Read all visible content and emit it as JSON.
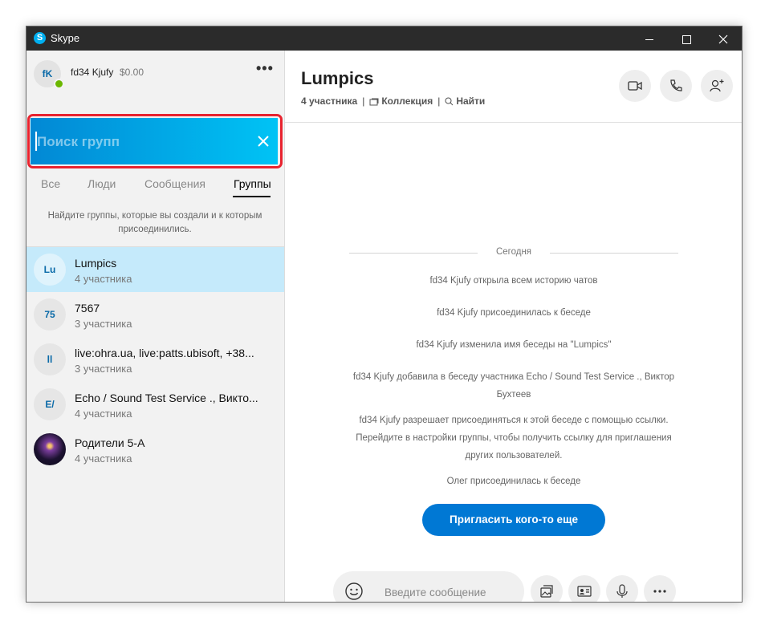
{
  "window": {
    "title": "Skype"
  },
  "profile": {
    "initials": "fK",
    "name": "fd34 Kjufy",
    "balance": "$0.00",
    "more": "•••"
  },
  "search": {
    "placeholder": "Поиск групп",
    "value": ""
  },
  "tabs": [
    {
      "label": "Все",
      "active": false
    },
    {
      "label": "Люди",
      "active": false
    },
    {
      "label": "Сообщения",
      "active": false
    },
    {
      "label": "Группы",
      "active": true
    }
  ],
  "hint": "Найдите группы, которые вы создали и к которым присоединились.",
  "groups": [
    {
      "initials": "Lu",
      "name": "Lumpics",
      "members": "4 участника",
      "selected": true
    },
    {
      "initials": "75",
      "name": "7567",
      "members": "3 участника",
      "selected": false
    },
    {
      "initials": "ll",
      "name": "live:ohra.ua, live:patts.ubisoft, +38...",
      "members": "3 участника",
      "selected": false
    },
    {
      "initials": "E/",
      "name": "Echo / Sound Test Service ., Викто...",
      "members": "4 участника",
      "selected": false
    },
    {
      "initials": "",
      "name": "Родители 5-А",
      "members": "4 участника",
      "selected": false,
      "photo": true
    }
  ],
  "chat": {
    "title": "Lumpics",
    "participants": "4 участника",
    "collection": "Коллекция",
    "find": "Найти",
    "separator": "|",
    "date": "Сегодня",
    "messages": [
      "fd34 Kjufy открыла всем историю чатов",
      "fd34 Kjufy присоединилась к беседе",
      "fd34 Kjufy изменила имя беседы на \"Lumpics\"",
      "fd34 Kjufy добавила в беседу участника Echo / Sound Test Service ., Виктор Бухтеев",
      "fd34 Kjufy разрешает присоединяться к этой беседе с помощью ссылки. Перейдите в настройки группы, чтобы получить ссылку для приглашения других пользователей.",
      "Олег присоединилась к беседе"
    ],
    "invite_button": "Пригласить кого-то еще",
    "composer_placeholder": "Введите сообщение"
  },
  "colors": {
    "brand": "#00aff0",
    "accent": "#0078d4",
    "highlight": "#e8232f",
    "online": "#6bb700"
  },
  "icons": [
    "video-call-icon",
    "audio-call-icon",
    "add-people-icon",
    "emoji-icon",
    "media-gallery-icon",
    "contact-card-icon",
    "microphone-icon",
    "more-icon",
    "close-icon"
  ]
}
